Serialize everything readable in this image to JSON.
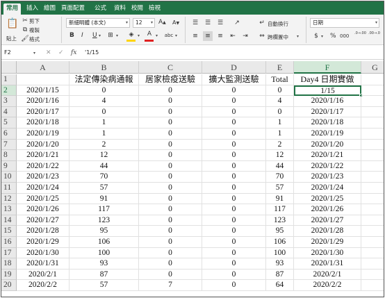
{
  "tabs": [
    "常用",
    "插入",
    "繪圖",
    "頁面配置",
    "公式",
    "資料",
    "校閱",
    "檢視"
  ],
  "active_tab": 0,
  "clipboard": {
    "paste": "貼上",
    "cut": "剪下",
    "copy": "複製",
    "format": "格式"
  },
  "font": {
    "name": "新細明體 (本文)",
    "size": "12",
    "grow": "A",
    "shrink": "A"
  },
  "format_buttons": {
    "bold": "B",
    "italic": "I",
    "underline": "U"
  },
  "alignment": {
    "wrap": "自動換行",
    "merge": "跨欄置中"
  },
  "number": {
    "format": "日期",
    "percent": "%",
    "comma": "000",
    "inc_decimal": ".0→.00",
    "dec_decimal": ".00→.0"
  },
  "formula_bar": {
    "name_box": "F2",
    "cancel": "✕",
    "enter": "✓",
    "fx": "fx",
    "content": "'1/15"
  },
  "columns": [
    "A",
    "B",
    "C",
    "D",
    "E",
    "F",
    "G"
  ],
  "selected_column": "F",
  "selected_row": 2,
  "headers": [
    "",
    "法定傳染病通報",
    "居家檢疫送驗",
    "擴大監測送驗",
    "Total",
    "Day4 日期實做"
  ],
  "rows": [
    [
      "2020/1/15",
      "0",
      "0",
      "0",
      "0",
      "1/15"
    ],
    [
      "2020/1/16",
      "4",
      "0",
      "0",
      "4",
      "2020/1/16"
    ],
    [
      "2020/1/17",
      "0",
      "0",
      "0",
      "0",
      "2020/1/17"
    ],
    [
      "2020/1/18",
      "1",
      "0",
      "0",
      "1",
      "2020/1/18"
    ],
    [
      "2020/1/19",
      "1",
      "0",
      "0",
      "1",
      "2020/1/19"
    ],
    [
      "2020/1/20",
      "2",
      "0",
      "0",
      "2",
      "2020/1/20"
    ],
    [
      "2020/1/21",
      "12",
      "0",
      "0",
      "12",
      "2020/1/21"
    ],
    [
      "2020/1/22",
      "44",
      "0",
      "0",
      "44",
      "2020/1/22"
    ],
    [
      "2020/1/23",
      "70",
      "0",
      "0",
      "70",
      "2020/1/23"
    ],
    [
      "2020/1/24",
      "57",
      "0",
      "0",
      "57",
      "2020/1/24"
    ],
    [
      "2020/1/25",
      "91",
      "0",
      "0",
      "91",
      "2020/1/25"
    ],
    [
      "2020/1/26",
      "117",
      "0",
      "0",
      "117",
      "2020/1/26"
    ],
    [
      "2020/1/27",
      "123",
      "0",
      "0",
      "123",
      "2020/1/27"
    ],
    [
      "2020/1/28",
      "95",
      "0",
      "0",
      "95",
      "2020/1/28"
    ],
    [
      "2020/1/29",
      "106",
      "0",
      "0",
      "106",
      "2020/1/29"
    ],
    [
      "2020/1/30",
      "100",
      "0",
      "0",
      "100",
      "2020/1/30"
    ],
    [
      "2020/1/31",
      "93",
      "0",
      "0",
      "93",
      "2020/1/31"
    ],
    [
      "2020/2/1",
      "87",
      "0",
      "0",
      "87",
      "2020/2/1"
    ],
    [
      "2020/2/2",
      "57",
      "7",
      "0",
      "64",
      "2020/2/2"
    ]
  ],
  "colors": {
    "accent": "#217346",
    "header_bg": "#e9e9e9",
    "font_color_bar": "#e02020",
    "fill_color_bar": "#ffd400"
  }
}
